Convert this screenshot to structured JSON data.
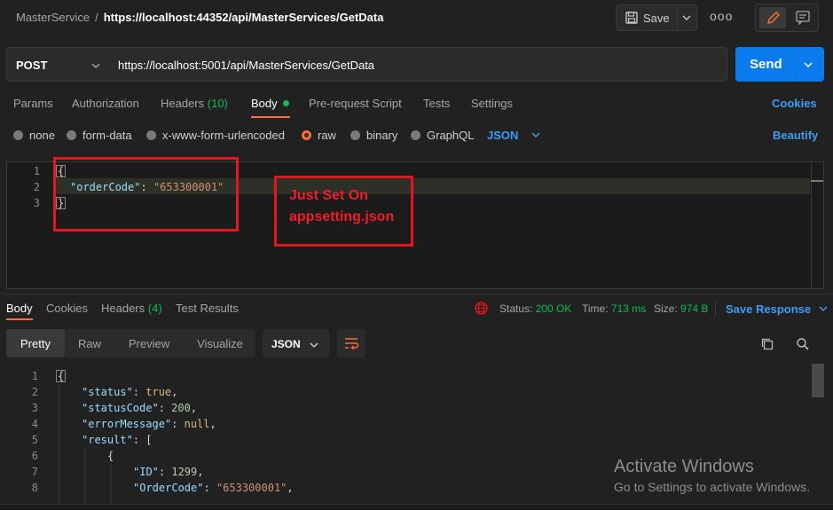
{
  "header": {
    "collection": "MasterService",
    "separator": "/",
    "request_title": "https://localhost:44352/api/MasterServices/GetData",
    "save_label": "Save",
    "more_label": "ooo"
  },
  "request": {
    "method": "POST",
    "url": "https://localhost:5001/api/MasterServices/GetData",
    "send_label": "Send"
  },
  "request_tabs": {
    "params": "Params",
    "authorization": "Authorization",
    "headers": "Headers",
    "headers_count": "(10)",
    "body": "Body",
    "prerequest": "Pre-request Script",
    "tests": "Tests",
    "settings": "Settings",
    "cookies": "Cookies"
  },
  "body_types": {
    "none": "none",
    "form_data": "form-data",
    "urlencoded": "x-www-form-urlencoded",
    "raw": "raw",
    "binary": "binary",
    "graphql": "GraphQL",
    "format": "JSON",
    "beautify": "Beautify"
  },
  "request_body": {
    "line_numbers": [
      "1",
      "2",
      "3"
    ],
    "open": "{",
    "key": "\"orderCode\"",
    "colon": ": ",
    "value": "\"653300001\"",
    "close": "}"
  },
  "annotation": {
    "line1": "Just Set On",
    "line2": "appsetting.json"
  },
  "response_tabs": {
    "body": "Body",
    "cookies": "Cookies",
    "headers": "Headers",
    "headers_count": "(4)",
    "test_results": "Test Results"
  },
  "status": {
    "status_label": "Status:",
    "status_value": "200 OK",
    "time_label": "Time:",
    "time_value": "713 ms",
    "size_label": "Size:",
    "size_value": "974 B",
    "save_response": "Save Response"
  },
  "response_view": {
    "pretty": "Pretty",
    "raw": "Raw",
    "preview": "Preview",
    "visualize": "Visualize",
    "format": "JSON"
  },
  "response_body": {
    "line_numbers": [
      "1",
      "2",
      "3",
      "4",
      "5",
      "6",
      "7",
      "8"
    ],
    "l1": "{",
    "status_key": "\"status\"",
    "status_val": "true",
    "statusCode_key": "\"statusCode\"",
    "statusCode_val": "200",
    "errorMessage_key": "\"errorMessage\"",
    "errorMessage_val": "null",
    "result_key": "\"result\"",
    "result_open": "[",
    "l6": "{",
    "id_key": "\"ID\"",
    "id_val": "1299",
    "ordercode_key": "\"OrderCode\"",
    "ordercode_val": "\"653300001\""
  },
  "watermark": {
    "title": "Activate Windows",
    "subtitle": "Go to Settings to activate Windows."
  },
  "colors": {
    "accent": "#ff6c37",
    "send": "#097bed",
    "link": "#3d9cf5",
    "success": "#0cbb52",
    "annotation": "#e3161e"
  }
}
